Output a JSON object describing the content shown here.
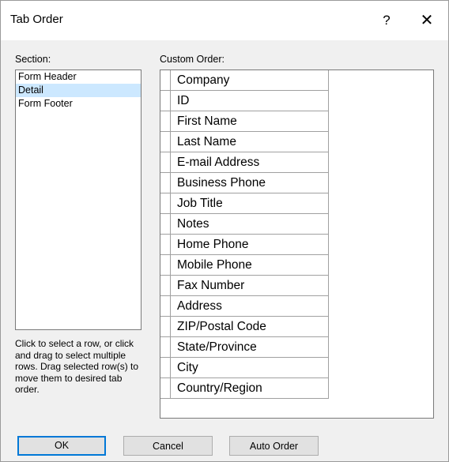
{
  "window": {
    "title": "Tab Order",
    "help_glyph": "?",
    "close_glyph": "✕"
  },
  "section": {
    "label": "Section:",
    "items": [
      "Form Header",
      "Detail",
      "Form Footer"
    ],
    "selected": "Detail"
  },
  "custom_order": {
    "label": "Custom Order:",
    "rows": [
      "Company",
      "ID",
      "First Name",
      "Last Name",
      "E-mail Address",
      "Business Phone",
      "Job Title",
      "Notes",
      "Home Phone",
      "Mobile Phone",
      "Fax Number",
      "Address",
      "ZIP/Postal Code",
      "State/Province",
      "City",
      "Country/Region"
    ]
  },
  "help_text": "Click to select a row, or click and drag to select multiple rows.  Drag selected row(s) to move them to desired tab order.",
  "buttons": {
    "ok": "OK",
    "cancel": "Cancel",
    "auto_order": "Auto Order"
  },
  "colors": {
    "selection": "#cce8ff",
    "default_button_border": "#0078d7"
  }
}
